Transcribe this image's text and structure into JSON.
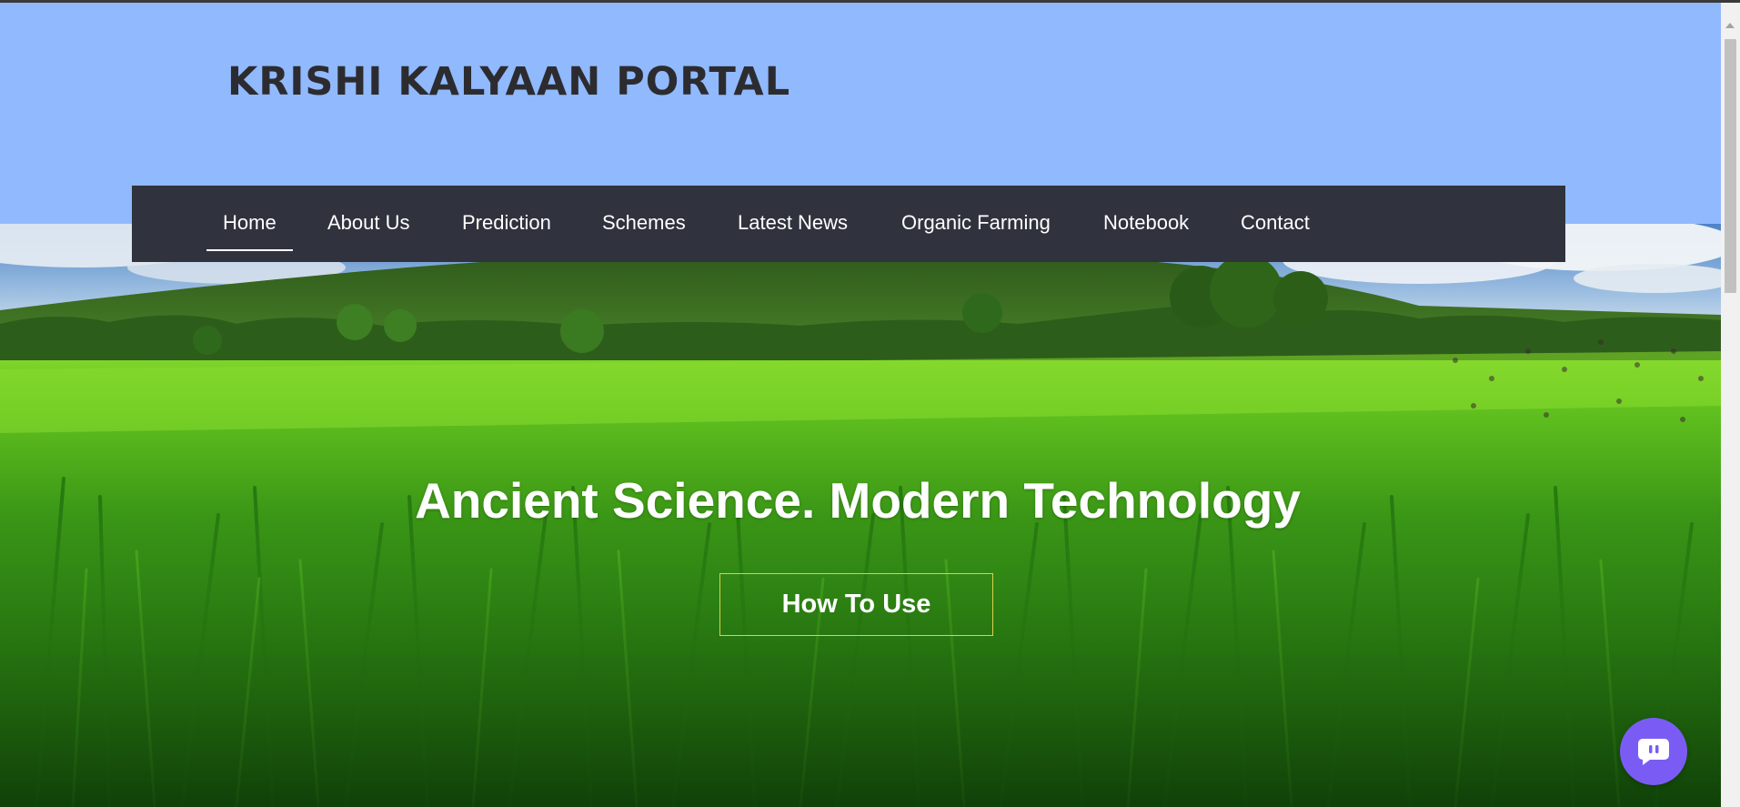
{
  "site": {
    "title": "KRISHI KALYAAN PORTAL"
  },
  "nav": {
    "items": [
      {
        "label": "Home",
        "active": true
      },
      {
        "label": "About Us",
        "active": false
      },
      {
        "label": "Prediction",
        "active": false
      },
      {
        "label": "Schemes",
        "active": false
      },
      {
        "label": "Latest News",
        "active": false
      },
      {
        "label": "Organic Farming",
        "active": false
      },
      {
        "label": "Notebook",
        "active": false
      },
      {
        "label": "Contact",
        "active": false
      }
    ]
  },
  "hero": {
    "heading": "Ancient Science. Modern Technology",
    "button_label": "How To Use",
    "image_description_icon": "landscape-image"
  },
  "chat": {
    "icon": "chat-bubble-icon"
  },
  "colors": {
    "header_bg": "#91b9fe",
    "nav_bg": "#30333d",
    "title_text": "#2c2c30",
    "button_border": "#d8d24a",
    "chat_bg": "#7a5cf5"
  }
}
